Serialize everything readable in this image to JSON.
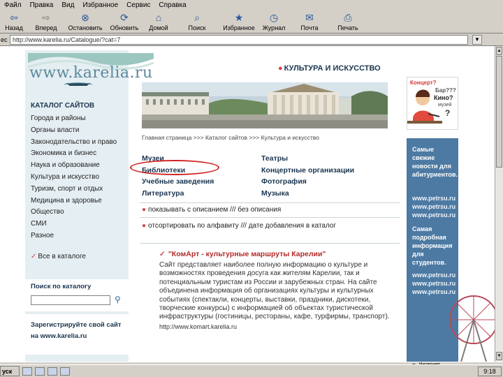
{
  "menubar": {
    "items": [
      "Файл",
      "Правка",
      "Вид",
      "Избранное",
      "Сервис",
      "Справка"
    ]
  },
  "toolbar": {
    "buttons": [
      {
        "label": "Назад",
        "icon": "back-arrow-icon"
      },
      {
        "label": "Вперед",
        "icon": "forward-arrow-icon"
      },
      {
        "label": "Остановить",
        "icon": "stop-icon"
      },
      {
        "label": "Обновить",
        "icon": "refresh-icon"
      },
      {
        "label": "Домой",
        "icon": "home-icon"
      },
      {
        "label": "Поиск",
        "icon": "search-icon"
      },
      {
        "label": "Избранное",
        "icon": "favorites-icon"
      },
      {
        "label": "Журнал",
        "icon": "history-icon"
      },
      {
        "label": "Почта",
        "icon": "mail-icon"
      },
      {
        "label": "Печать",
        "icon": "print-icon"
      }
    ]
  },
  "address": {
    "label": "ес",
    "value": "http://www.karelia.ru/Catalogue/?cat=7"
  },
  "site": {
    "logo_text": "www.karelia.ru",
    "catalog_title": "КАТАЛОГ САЙТОВ",
    "catalog_items": [
      "Города и районы",
      "Органы власти",
      "Законодательство и право",
      "Экономика и бизнес",
      "Наука и образование",
      "Культура и искусство",
      "Туризм, спорт и отдых",
      "Медицина и здоровье",
      "Общество",
      "СМИ",
      "Разное"
    ],
    "all_catalog": "Все в каталоге",
    "search_title": "Поиск по каталогу",
    "register_title": "Зарегистрируйте свой сайт на www.karelia.ru",
    "section_title": "КУЛЬТУРА И ИСКУССТВО",
    "breadcrumb": "Главная страница >>> Каталог сайтов >>> Культура и искусство",
    "categories_left": [
      "Музеи",
      "Библиотеки",
      "Учебные заведения",
      "Литература"
    ],
    "categories_right": [
      "Театры",
      "Концертные организации",
      "Фотография",
      "Музыка"
    ],
    "option1": "показывать с описанием /// без описания",
    "option2": "отсортировать по алфавиту /// дате добавления в каталог",
    "feature_title": "\"КомАрт - культурные маршруты Карелии\"",
    "feature_desc": "Сайт представляет наиболее полную информацию о культуре и возможностях проведения досуга как жителям Карелии, так и потенциальным туристам из России и зарубежных стран. На сайте объединена информация об организациях культуры и культурных событиях (спектакли, концерты, выставки, праздники, дискотеки, творческие конкурсы) с информацией об объектах туристической инфраструктуры (гостиницы, рестораны, кафе, турфирмы, транспорт).",
    "feature_url": "http://www.komart.karelia.ru",
    "promo_text": [
      "Концерт?",
      "Бар???",
      "Кино?",
      "музей",
      "?"
    ],
    "right_block1": "Самые свежие новости для абитуриентов.",
    "right_links1": [
      "www.petrsu.ru",
      "www.petrsu.ru",
      "www.petrsu.ru"
    ],
    "right_block2": "Самая подробная информация для студентов.",
    "right_links2": [
      "www.petrsu.ru",
      "www.petrsu.ru",
      "www.petrsu.ru"
    ]
  },
  "status": {
    "zone": "Интернет"
  },
  "taskbar": {
    "start": "уск",
    "clock": "9:18"
  }
}
